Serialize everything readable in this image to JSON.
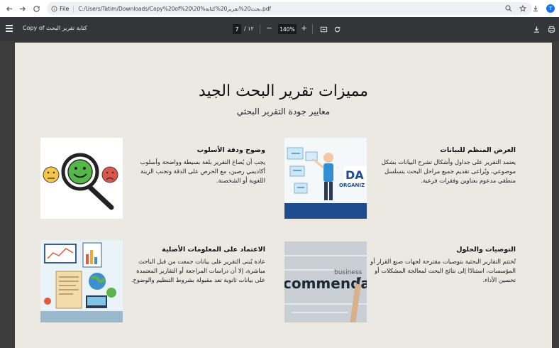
{
  "browser": {
    "back_icon": "arrow-left-icon",
    "forward_icon": "arrow-right-icon",
    "reload_icon": "reload-icon",
    "file_label": "File",
    "url": "C:/Users/Tatim/Downloads/Copy%20of%20\\20%بحث20%تقرير20%كتابة.pdf",
    "avatar_letter": "T"
  },
  "pdf_toolbar": {
    "title": "Copy of كتابة تقرير البحث",
    "current_page": "7",
    "page_total": "/ ١٢",
    "zoom_minus": "−",
    "zoom_value": "140%",
    "zoom_plus": "+"
  },
  "slide": {
    "title": "مميزات تقرير البحث الجيد",
    "subtitle": "معايير جودة التقرير البحثي",
    "cards": [
      {
        "heading": "وضوح ودقة الأسلوب",
        "body": "يجب أن يُصاغ التقرير بلغة بسيطة وواضحة وأسلوب أكاديمي رصين، مع الحرص على الدقة وتجنب الزينة اللغوية أو الشخصنة."
      },
      {
        "heading": "العرض المنظم للبيانات",
        "body": "يعتمد التقرير على جداول وأشكال تشرح البيانات بشكل موضوعي، ويُراعى تقديم جميع مراحل البحث بتسلسل منطقي مدعوم بعناوين وفقرات فرعية."
      },
      {
        "heading": "الاعتماد على المعلومات الأصلية",
        "body": "عادة يُبنى التقرير على بيانات جمعت من قبل الباحث مباشرة، إلا أن دراسات المراجعة أو التقارير المعتمدة على بيانات ثانوية تعد مقبولة بشروط التنظيم والوضوح."
      },
      {
        "heading": "التوصيات والحلول",
        "body": "تُختتم التقارير البحثية بتوصيات مقترحة لجهات صنع القرار أو المؤسسات، استنادًا إلى نتائج البحث لمعالجة المشكلات أو تحسين الأداء."
      }
    ],
    "image_words": {
      "da": "DA",
      "organ": "ORGANIZ",
      "business": "business",
      "commendations": "commendati"
    }
  },
  "colors": {
    "slide_bg": "#ebe9e2",
    "toolbar_bg": "#323639",
    "viewer_bg": "#3c3c3c"
  }
}
